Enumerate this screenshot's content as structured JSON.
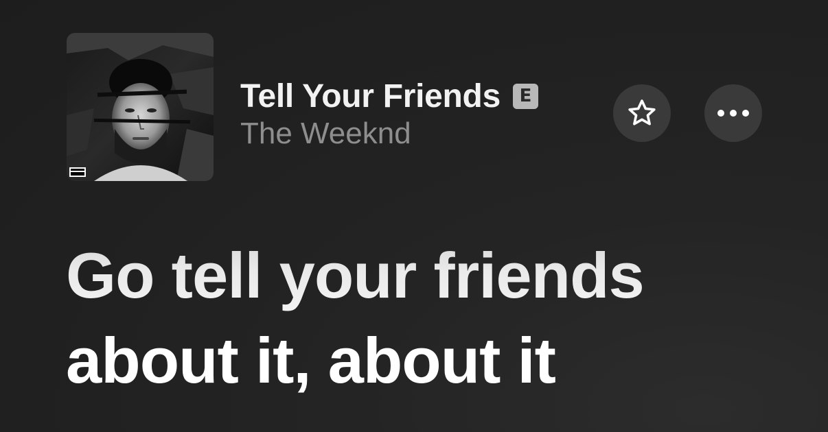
{
  "track": {
    "title": "Tell Your Friends",
    "artist": "The Weeknd",
    "explicit_badge": "E",
    "artwork_icon": "album-artwork-portrait"
  },
  "controls": {
    "favorite_icon": "star-outline-icon",
    "more_icon": "ellipsis-icon"
  },
  "lyrics": {
    "lines": [
      "Go tell your friends",
      "about it, about it"
    ]
  },
  "colors": {
    "background": "#202020",
    "button_background": "#3a3a3a",
    "artist_text": "#8e8e8e",
    "badge": "#b8b8b8"
  }
}
